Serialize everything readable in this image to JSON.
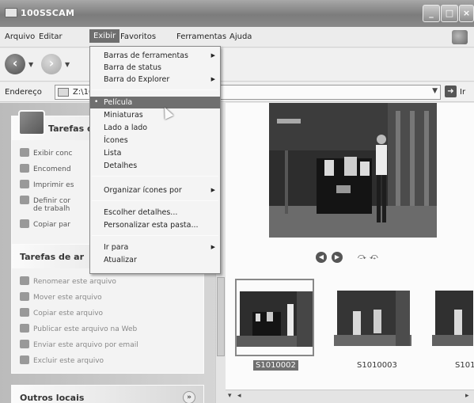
{
  "window": {
    "title": "100SSCAM"
  },
  "menubar": {
    "items": [
      "Arquivo",
      "Editar",
      "Exibir",
      "Favoritos",
      "Ferramentas",
      "Ajuda"
    ],
    "active": "Exibir"
  },
  "address": {
    "label": "Endereço",
    "value": "Z:\\10",
    "go_label": "Ir"
  },
  "view_menu": {
    "items": [
      {
        "label": "Barras de ferramentas",
        "submenu": true
      },
      {
        "label": "Barra de status"
      },
      {
        "label": "Barra do Explorer",
        "submenu": true
      },
      {
        "label": "Película",
        "selected": true,
        "highlighted": true
      },
      {
        "label": "Miniaturas"
      },
      {
        "label": "Lado a lado"
      },
      {
        "label": "Ícones"
      },
      {
        "label": "Lista"
      },
      {
        "label": "Detalhes"
      },
      {
        "label": "Organizar ícones por",
        "submenu": true
      },
      {
        "label": "Escolher detalhes..."
      },
      {
        "label": "Personalizar esta pasta..."
      },
      {
        "label": "Ir para",
        "submenu": true
      },
      {
        "label": "Atualizar"
      }
    ]
  },
  "left_panels": {
    "picture_tasks": {
      "title": "Tarefas d",
      "items": [
        "Exibir conc",
        "Encomend",
        "Imprimir es",
        "Definir cor",
        "de trabalh",
        "Copiar par"
      ]
    },
    "file_tasks": {
      "title": "Tarefas de ar",
      "items": [
        "Renomear este arquivo",
        "Mover este arquivo",
        "Copiar este arquivo",
        "Publicar este arquivo na Web",
        "Enviar este arquivo por email",
        "Excluir este arquivo"
      ]
    },
    "other_places": {
      "title": "Outros locais"
    }
  },
  "filmstrip": {
    "thumbnails": [
      {
        "label": "S1010002",
        "selected": true
      },
      {
        "label": "S1010003",
        "selected": false
      },
      {
        "label": "S101",
        "selected": false
      }
    ]
  },
  "icons": {
    "back": "back-arrow-icon",
    "forward": "forward-arrow-icon",
    "prev": "previous-image-icon",
    "next": "next-image-icon",
    "rotate_cw": "rotate-clockwise-icon",
    "rotate_ccw": "rotate-counterclockwise-icon"
  }
}
